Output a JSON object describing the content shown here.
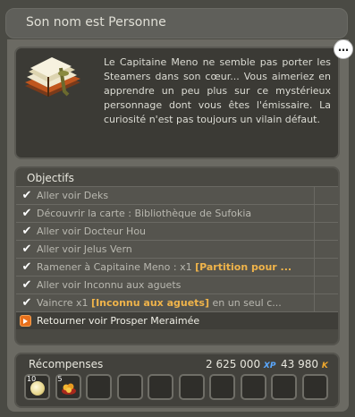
{
  "title": "Son nom est Personne",
  "description": "Le Capitaine Meno ne semble pas porter les Steamers dans son cœur... Vous aimeriez en apprendre un peu plus sur ce mystérieux personnage dont vous êtes l'émissaire. La curiosité n'est pas toujours un vilain défaut.",
  "speech_icon": "…",
  "objectives_header": "Objectifs",
  "objectives": [
    {
      "text": "Aller voir Deks",
      "done": true
    },
    {
      "text": "Découvrir la carte : Bibliothèque de Sufokia",
      "done": true
    },
    {
      "text": "Aller voir Docteur Hou",
      "done": true
    },
    {
      "text": "Aller voir Jelus Vern",
      "done": true
    },
    {
      "text": "Ramener à Capitaine Meno : x1 ",
      "highlight": "[Partition pour ...",
      "done": true
    },
    {
      "text": "Aller voir Inconnu aux aguets",
      "done": true
    },
    {
      "text": "Vaincre x1 ",
      "highlight": "[Inconnu aux aguets]",
      "suffix": " en un seul c...",
      "done": true
    },
    {
      "text": "Retourner voir Prosper Meraimée",
      "done": false
    }
  ],
  "check_glyph": "✔",
  "rewards_label": "Récompenses",
  "xp_value": "2 625 000",
  "xp_badge": "XP",
  "kamas_value": "43 980",
  "kamas_badge": "K",
  "reward_items": [
    {
      "qty": "10",
      "icon": "orb-icon"
    },
    {
      "qty": "5",
      "icon": "treasure-icon"
    }
  ]
}
